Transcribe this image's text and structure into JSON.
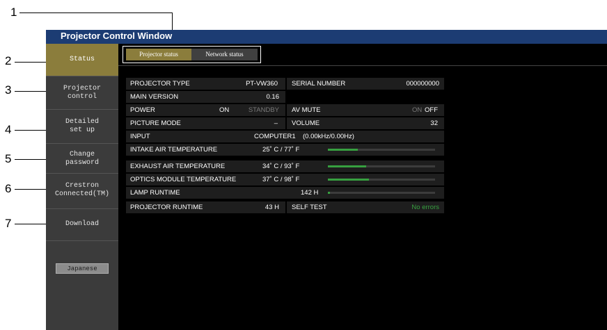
{
  "window": {
    "title": "Projector Control Window"
  },
  "callouts": [
    "1",
    "2",
    "3",
    "4",
    "5",
    "6",
    "7"
  ],
  "sidebar": {
    "items": [
      {
        "label_lines": [
          "Status"
        ]
      },
      {
        "label_lines": [
          "Projector",
          "control"
        ]
      },
      {
        "label_lines": [
          "Detailed",
          "set up"
        ]
      },
      {
        "label_lines": [
          "Change",
          "password"
        ]
      },
      {
        "label_lines": [
          "Crestron",
          "Connected(TM)"
        ]
      },
      {
        "label_lines": [
          "Download"
        ]
      }
    ],
    "language_button": "Japanese"
  },
  "tabs": {
    "projector_status": "Projector status",
    "network_status": "Network status"
  },
  "status": {
    "projector_type_label": "PROJECTOR TYPE",
    "projector_type": "PT-VW360",
    "serial_label": "SERIAL NUMBER",
    "serial": "000000000",
    "main_version_label": "MAIN VERSION",
    "main_version": "0.16",
    "power_label": "POWER",
    "power_on": "ON",
    "power_standby": "STANDBY",
    "av_mute_label": "AV MUTE",
    "av_mute_on": "ON",
    "av_mute_off": "OFF",
    "picture_mode_label": "PICTURE MODE",
    "picture_mode": "–",
    "volume_label": "VOLUME",
    "volume": "32",
    "input_label": "INPUT",
    "input": "COMPUTER1",
    "input_freq": "(0.00kHz/0.00Hz)",
    "intake_label": "INTAKE AIR TEMPERATURE",
    "intake": "25˚ C / 77˚  F",
    "intake_level": 0.28,
    "exhaust_label": "EXHAUST AIR TEMPERATURE",
    "exhaust": "34˚ C / 93˚  F",
    "exhaust_level": 0.36,
    "optics_label": "OPTICS MODULE TEMPERATURE",
    "optics": "37˚ C / 98˚  F",
    "optics_level": 0.38,
    "lamp_label": "LAMP RUNTIME",
    "lamp": "142 H",
    "lamp_level": 0.02,
    "proj_runtime_label": "PROJECTOR RUNTIME",
    "proj_runtime": "43 H",
    "self_test_label": "SELF TEST",
    "self_test": "No errors"
  }
}
